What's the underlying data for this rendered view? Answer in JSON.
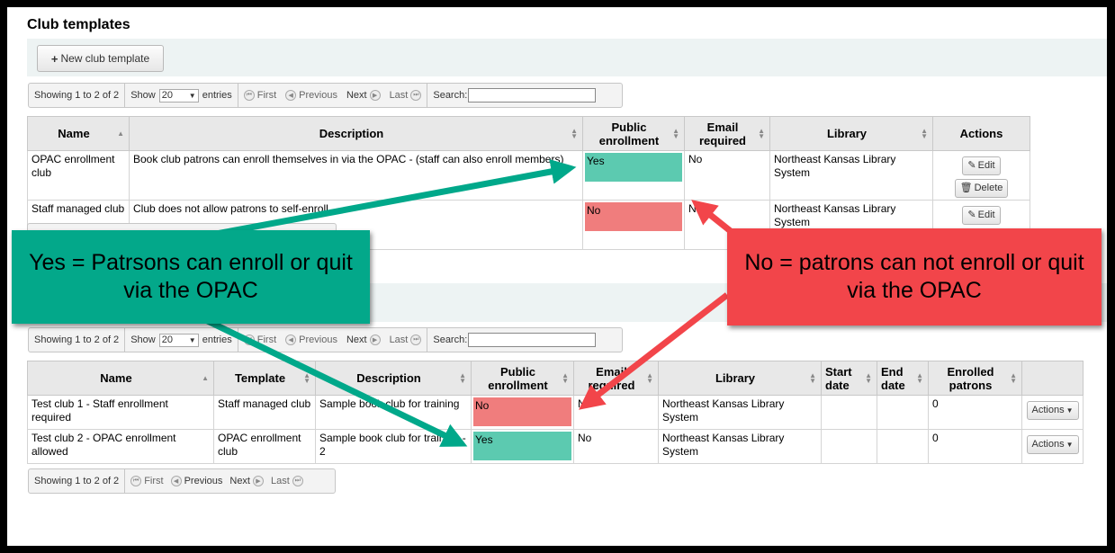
{
  "templates": {
    "heading": "Club templates",
    "new_button_label": "New club template",
    "pager": {
      "info": "Showing 1 to 2 of 2",
      "show_label": "Show",
      "show_value": "20",
      "entries_label": "entries",
      "first": "First",
      "previous": "Previous",
      "next": "Next",
      "last": "Last",
      "search_label": "Search:"
    },
    "columns": [
      "Name",
      "Description",
      "Public enrollment",
      "Email required",
      "Library",
      "Actions"
    ],
    "rows": [
      {
        "name": "OPAC enrollment club",
        "description": "Book club patrons can enroll themselves in via the OPAC - (staff can also enroll members)",
        "public": "Yes",
        "email": "No",
        "library": "Northeast Kansas Library System"
      },
      {
        "name": "Staff managed club",
        "description": "Club does not allow patrons to self-enroll",
        "public": "No",
        "email": "No",
        "library": "Northeast Kansas Library System"
      }
    ],
    "edit_label": "Edit",
    "delete_label": "Delete"
  },
  "clubs": {
    "pager": {
      "info": "Showing 1 to 2 of 2",
      "show_label": "Show",
      "show_value": "20",
      "entries_label": "entries",
      "first": "First",
      "previous": "Previous",
      "next": "Next",
      "last": "Last",
      "search_label": "Search:"
    },
    "columns": [
      "Name",
      "Template",
      "Description",
      "Public enrollment",
      "Email required",
      "Library",
      "Start date",
      "End date",
      "Enrolled patrons",
      ""
    ],
    "rows": [
      {
        "name": "Test club 1 - Staff enrollment required",
        "template": "Staff managed club",
        "description": "Sample book club for training",
        "public": "No",
        "email": "No",
        "library": "Northeast Kansas Library System",
        "start": "",
        "end": "",
        "enrolled": "0"
      },
      {
        "name": "Test club 2 - OPAC enrollment allowed",
        "template": "OPAC enrollment club",
        "description": "Sample book club for training - 2",
        "public": "Yes",
        "email": "No",
        "library": "Northeast Kansas Library System",
        "start": "",
        "end": "",
        "enrolled": "0"
      }
    ],
    "actions_label": "Actions",
    "bottom_pager": {
      "info": "Showing 1 to 2 of 2",
      "first": "First",
      "previous": "Previous",
      "next": "Next",
      "last": "Last"
    }
  },
  "callouts": {
    "yes_text": "Yes = Patrsons can enroll or quit via the OPAC",
    "no_text": "No = patrons can not enroll or quit via the OPAC"
  },
  "colors": {
    "yes": "#5ccab0",
    "no": "#f07d7d",
    "green_callout": "#03a88a",
    "red_callout": "#f2454a"
  },
  "icons": {
    "new": "plus-icon",
    "edit": "pencil-icon",
    "delete": "trash-icon",
    "actions": "caret-down-icon"
  }
}
